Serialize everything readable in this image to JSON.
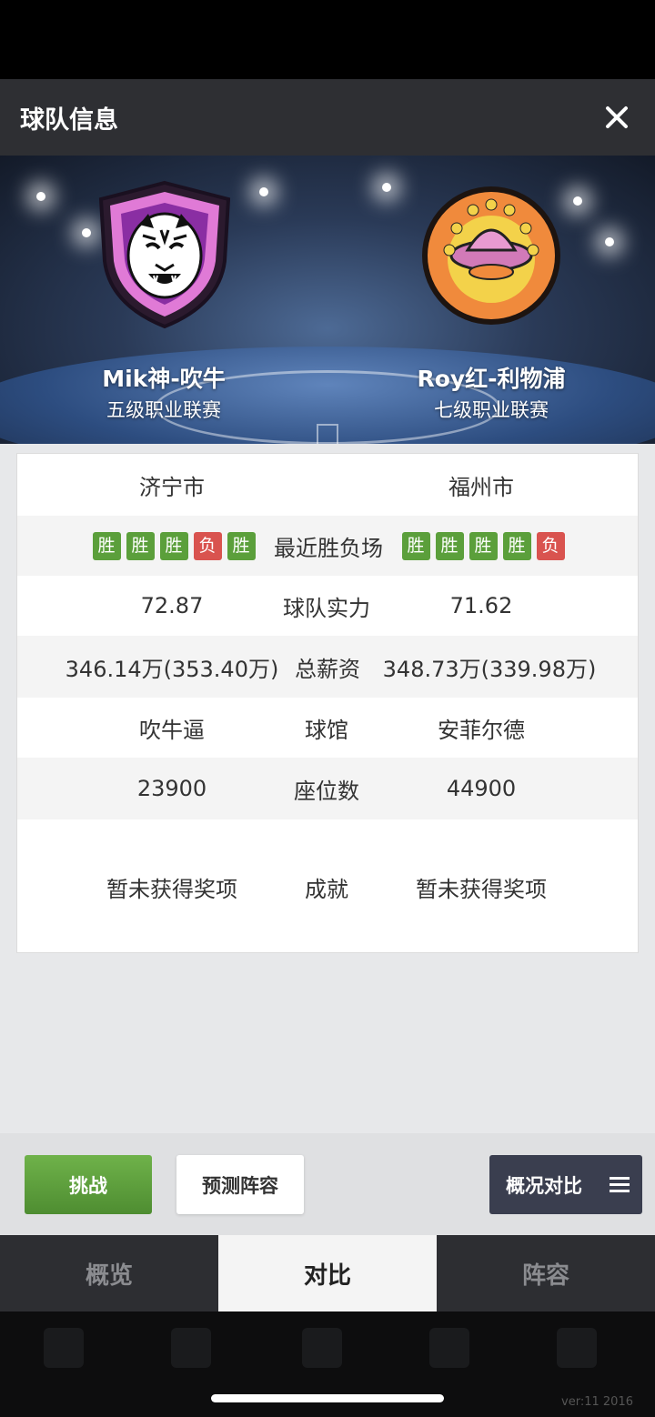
{
  "header": {
    "title": "球队信息",
    "close_icon": "close-icon"
  },
  "teams": {
    "home": {
      "name": "Mik神-吹牛",
      "league": "五级职业联赛",
      "logo": "tiger-shield-logo"
    },
    "away": {
      "name": "Roy红-利物浦",
      "league": "七级职业联赛",
      "logo": "ufo-badge-logo"
    }
  },
  "stats": {
    "city": {
      "left": "济宁市",
      "right": "福州市"
    },
    "recent": {
      "label": "最近胜负场",
      "left": [
        "胜",
        "胜",
        "胜",
        "负",
        "胜"
      ],
      "right": [
        "胜",
        "胜",
        "胜",
        "胜",
        "负"
      ]
    },
    "strength": {
      "label": "球队实力",
      "left": "72.87",
      "right": "71.62"
    },
    "salary": {
      "label": "总薪资",
      "left": "346.14万(353.40万)",
      "right": "348.73万(339.98万)"
    },
    "arena": {
      "label": "球馆",
      "left": "吹牛逼",
      "right": "安菲尔德"
    },
    "seats": {
      "label": "座位数",
      "left": "23900",
      "right": "44900"
    },
    "achievements": {
      "label": "成就",
      "left": "暂未获得奖项",
      "right": "暂未获得奖项"
    }
  },
  "buttons": {
    "challenge": "挑战",
    "predict": "预测阵容",
    "compare": "概况对比"
  },
  "tabs": [
    {
      "label": "概览",
      "active": false
    },
    {
      "label": "对比",
      "active": true
    },
    {
      "label": "阵容",
      "active": false
    }
  ],
  "version": "ver:11  2016",
  "colors": {
    "win": "#5b9f3b",
    "loss": "#d9534f",
    "challenge": "#5ea33c",
    "header": "#2e2f33"
  }
}
